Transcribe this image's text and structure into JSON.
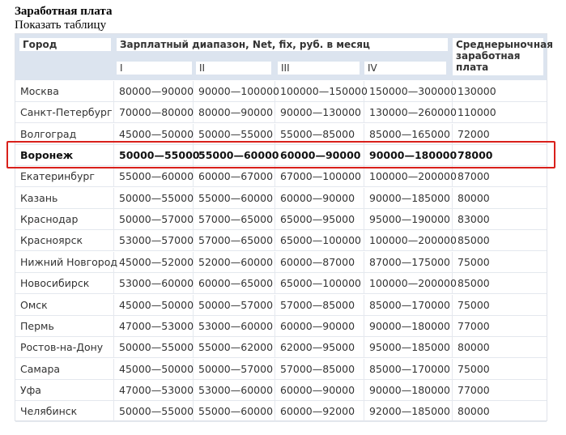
{
  "title": "Заработная плата",
  "toggle_label": "Показать таблицу",
  "header": {
    "city": "Город",
    "range": "Зарплатный диапазон, Net, fix, руб. в месяц",
    "levels": [
      "I",
      "II",
      "III",
      "IV"
    ],
    "average": "Среднерыночная заработная плата"
  },
  "rows": [
    {
      "city": "Москва",
      "i": "80000—90000",
      "ii": "90000—100000",
      "iii": "100000—150000",
      "iv": "150000—300000",
      "avg": "130000"
    },
    {
      "city": "Санкт-Петербург",
      "i": "70000—80000",
      "ii": "80000—90000",
      "iii": "90000—130000",
      "iv": "130000—260000",
      "avg": "110000"
    },
    {
      "city": "Волгоград",
      "i": "45000—50000",
      "ii": "50000—55000",
      "iii": "55000—85000",
      "iv": "85000—165000",
      "avg": "72000"
    },
    {
      "city": "Воронеж",
      "i": "50000—55000",
      "ii": "55000—60000",
      "iii": "60000—90000",
      "iv": "90000—180000",
      "avg": "78000"
    },
    {
      "city": "Екатеринбург",
      "i": "55000—60000",
      "ii": "60000—67000",
      "iii": "67000—100000",
      "iv": "100000—200000",
      "avg": "87000"
    },
    {
      "city": "Казань",
      "i": "50000—55000",
      "ii": "55000—60000",
      "iii": "60000—90000",
      "iv": "90000—185000",
      "avg": "80000"
    },
    {
      "city": "Краснодар",
      "i": "50000—57000",
      "ii": "57000—65000",
      "iii": "65000—95000",
      "iv": "95000—190000",
      "avg": "83000"
    },
    {
      "city": "Красноярск",
      "i": "53000—57000",
      "ii": "57000—65000",
      "iii": "65000—100000",
      "iv": "100000—200000",
      "avg": "85000"
    },
    {
      "city": "Нижний Новгород",
      "i": "45000—52000",
      "ii": "52000—60000",
      "iii": "60000—87000",
      "iv": "87000—175000",
      "avg": "75000"
    },
    {
      "city": "Новосибирск",
      "i": "53000—60000",
      "ii": "60000—65000",
      "iii": "65000—100000",
      "iv": "100000—200000",
      "avg": "85000"
    },
    {
      "city": "Омск",
      "i": "45000—50000",
      "ii": "50000—57000",
      "iii": "57000—85000",
      "iv": "85000—170000",
      "avg": "75000"
    },
    {
      "city": "Пермь",
      "i": "47000—53000",
      "ii": "53000—60000",
      "iii": "60000—90000",
      "iv": "90000—180000",
      "avg": "77000"
    },
    {
      "city": "Ростов-на-Дону",
      "i": "50000—55000",
      "ii": "55000—62000",
      "iii": "62000—95000",
      "iv": "95000—185000",
      "avg": "80000"
    },
    {
      "city": "Самара",
      "i": "45000—50000",
      "ii": "50000—57000",
      "iii": "57000—85000",
      "iv": "85000—170000",
      "avg": "75000"
    },
    {
      "city": "Уфа",
      "i": "47000—53000",
      "ii": "53000—60000",
      "iii": "60000—90000",
      "iv": "90000—180000",
      "avg": "77000"
    },
    {
      "city": "Челябинск",
      "i": "50000—55000",
      "ii": "55000—60000",
      "iii": "60000—92000",
      "iv": "92000—185000",
      "avg": "80000"
    }
  ],
  "highlighted_city": "Воронеж",
  "highlight_color": "#d9201b",
  "header_background": "#dce4ef"
}
